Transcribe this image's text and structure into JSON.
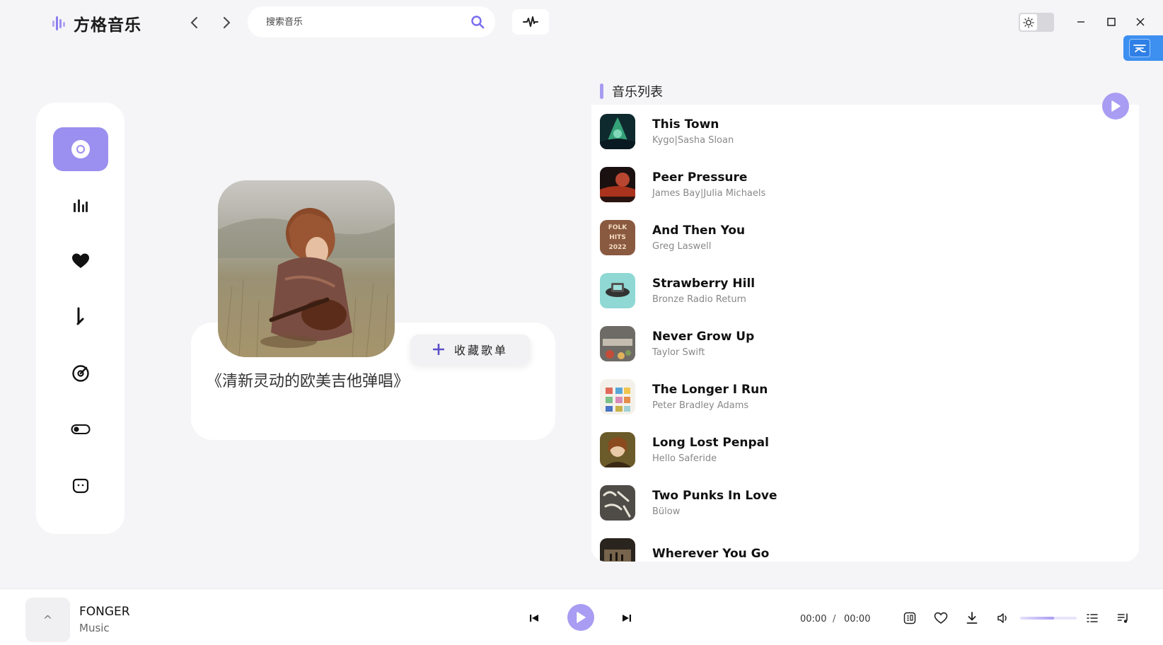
{
  "app": {
    "title": "方格音乐"
  },
  "search": {
    "placeholder": "搜索音乐"
  },
  "colors": {
    "accent": "#a99cf3",
    "sidebar_active": "#9b8ff0",
    "background": "#f5f5f7",
    "badge": "#3d8ff0"
  },
  "sidebar": {
    "items": [
      {
        "icon": "disc-icon",
        "active": true
      },
      {
        "icon": "bar-chart-icon",
        "active": false
      },
      {
        "icon": "heart-icon",
        "active": false
      },
      {
        "icon": "music-note-icon",
        "active": false
      },
      {
        "icon": "target-icon",
        "active": false
      },
      {
        "icon": "toggle-icon",
        "active": false
      },
      {
        "icon": "chat-icon",
        "active": false
      }
    ]
  },
  "playlist": {
    "title": "《清新灵动的欧美吉他弹唱》",
    "collect_label": "收藏歌单"
  },
  "music_list": {
    "header": "音乐列表",
    "songs": [
      {
        "title": "This Town",
        "artist": "Kygo|Sasha Sloan"
      },
      {
        "title": "Peer Pressure",
        "artist": "James Bay|Julia Michaels"
      },
      {
        "title": "And Then You",
        "artist": "Greg Laswell",
        "cover_text": [
          "FOLK",
          "HITS",
          "2022"
        ]
      },
      {
        "title": "Strawberry Hill",
        "artist": "Bronze Radio Return"
      },
      {
        "title": "Never Grow Up",
        "artist": "Taylor Swift"
      },
      {
        "title": "The Longer I Run",
        "artist": "Peter Bradley Adams"
      },
      {
        "title": "Long Lost Penpal",
        "artist": "Hello Saferide"
      },
      {
        "title": "Two Punks In Love",
        "artist": "Bülow"
      },
      {
        "title": "Wherever You Go",
        "artist": ""
      }
    ]
  },
  "player": {
    "expand_glyph": "^",
    "title": "FONGER",
    "subtitle": "Music",
    "current_time": "00:00",
    "separator": "/",
    "total_time": "00:00",
    "volume": 0.6
  }
}
